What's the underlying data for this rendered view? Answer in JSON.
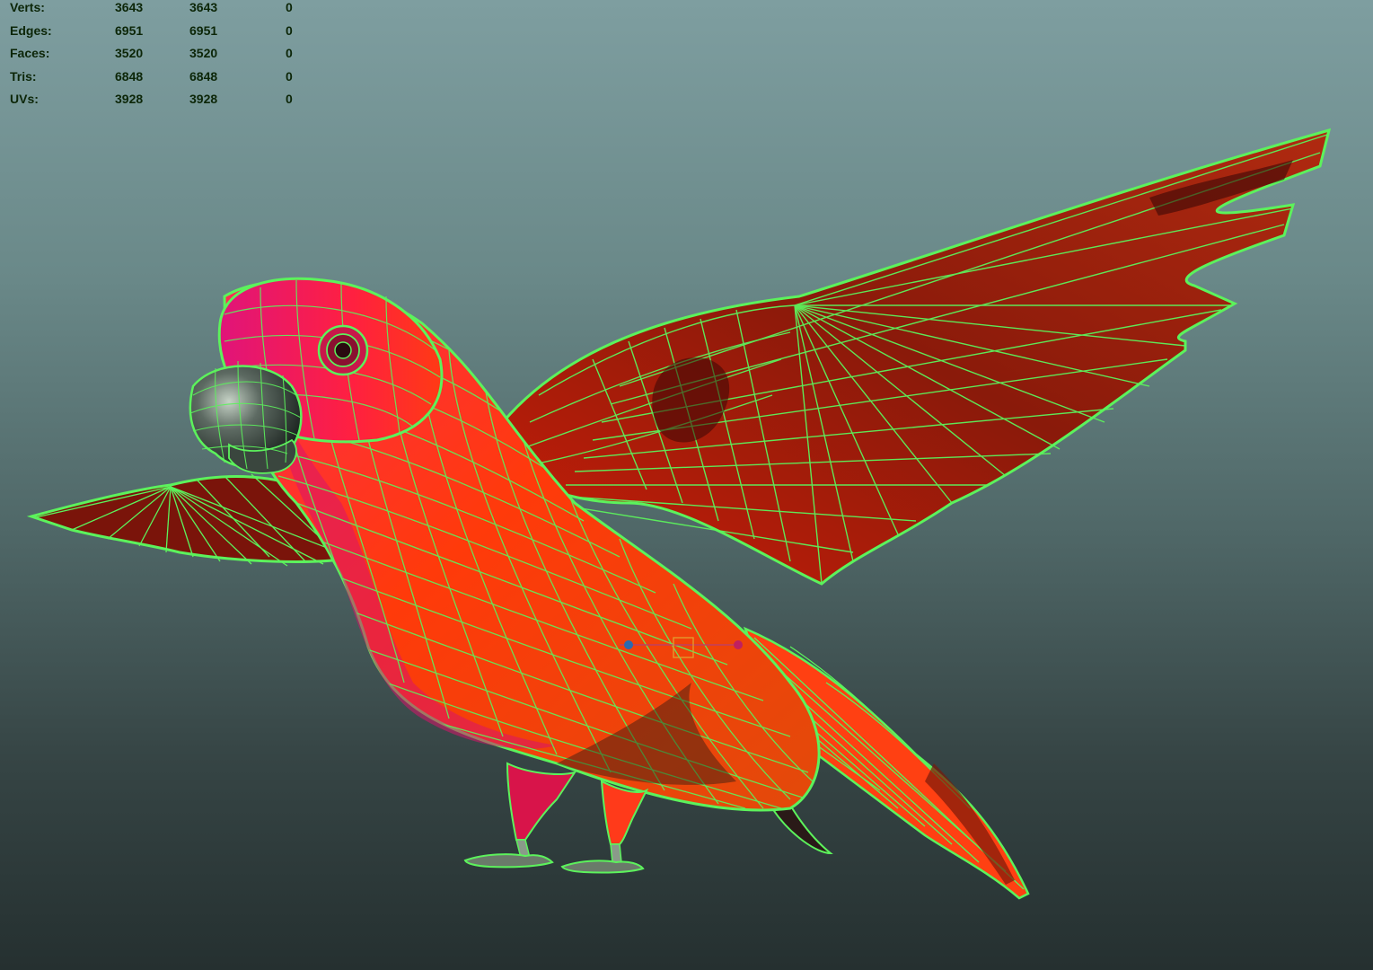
{
  "viewport": {
    "background_top": "#7e9ea0",
    "background_bottom": "#253030"
  },
  "hud": {
    "rows": [
      {
        "label": "Verts:",
        "values": [
          "3643",
          "3643",
          "0"
        ]
      },
      {
        "label": "Edges:",
        "values": [
          "6951",
          "6951",
          "0"
        ]
      },
      {
        "label": "Faces:",
        "values": [
          "3520",
          "3520",
          "0"
        ]
      },
      {
        "label": "Tris:",
        "values": [
          "6848",
          "6848",
          "0"
        ]
      },
      {
        "label": "UVs:",
        "values": [
          "3928",
          "3928",
          "0"
        ]
      }
    ],
    "text_color": "#0c2608"
  },
  "model": {
    "wireframe_color": "#5cf25c",
    "body_color": "#ff3a0a",
    "head_color": "#e8184a",
    "wing_shade": "#5a0f08",
    "manipulator_icon": "move-manipulator-icon"
  }
}
